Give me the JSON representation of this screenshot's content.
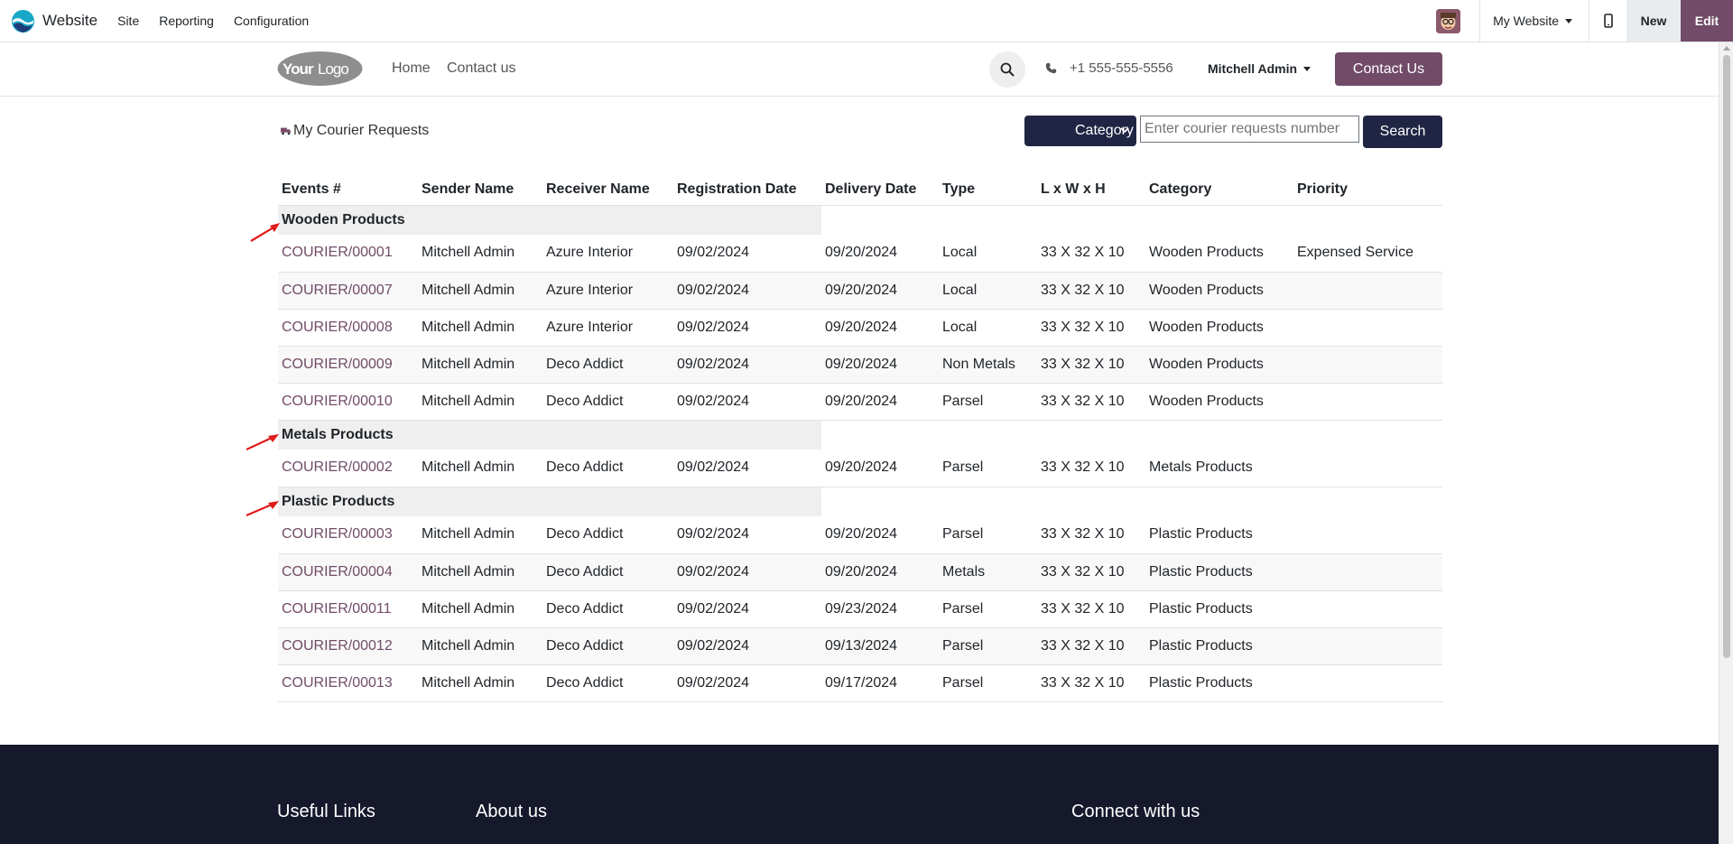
{
  "adminbar": {
    "app_title": "Website",
    "menus": [
      "Site",
      "Reporting",
      "Configuration"
    ],
    "site_switcher": "My Website",
    "new_label": "New",
    "edit_label": "Edit",
    "colors": {
      "edit_bg": "#714b67"
    }
  },
  "header": {
    "logo_text": "YourLogo",
    "nav": [
      "Home",
      "Contact us"
    ],
    "phone": "+1 555-555-5556",
    "user": "Mitchell Admin",
    "cta": "Contact Us"
  },
  "page": {
    "title": "My Courier Requests",
    "filter_selected": "Category",
    "search_placeholder": "Enter courier requests number",
    "search_button": "Search"
  },
  "table": {
    "columns": [
      "Events #",
      "Sender Name",
      "Receiver Name",
      "Registration Date",
      "Delivery Date",
      "Type",
      "L x W x H",
      "Category",
      "Priority"
    ],
    "groups": [
      {
        "name": "Wooden Products",
        "rows": [
          [
            "COURIER/00001",
            "Mitchell Admin",
            "Azure Interior",
            "09/02/2024",
            "09/20/2024",
            "Local",
            "33 X 32 X 10",
            "Wooden Products",
            "Expensed Service"
          ],
          [
            "COURIER/00007",
            "Mitchell Admin",
            "Azure Interior",
            "09/02/2024",
            "09/20/2024",
            "Local",
            "33 X 32 X 10",
            "Wooden Products",
            ""
          ],
          [
            "COURIER/00008",
            "Mitchell Admin",
            "Azure Interior",
            "09/02/2024",
            "09/20/2024",
            "Local",
            "33 X 32 X 10",
            "Wooden Products",
            ""
          ],
          [
            "COURIER/00009",
            "Mitchell Admin",
            "Deco Addict",
            "09/02/2024",
            "09/20/2024",
            "Non Metals",
            "33 X 32 X 10",
            "Wooden Products",
            ""
          ],
          [
            "COURIER/00010",
            "Mitchell Admin",
            "Deco Addict",
            "09/02/2024",
            "09/20/2024",
            "Parsel",
            "33 X 32 X 10",
            "Wooden Products",
            ""
          ]
        ]
      },
      {
        "name": "Metals Products",
        "rows": [
          [
            "COURIER/00002",
            "Mitchell Admin",
            "Deco Addict",
            "09/02/2024",
            "09/20/2024",
            "Parsel",
            "33 X 32 X 10",
            "Metals Products",
            ""
          ]
        ]
      },
      {
        "name": "Plastic Products",
        "rows": [
          [
            "COURIER/00003",
            "Mitchell Admin",
            "Deco Addict",
            "09/02/2024",
            "09/20/2024",
            "Parsel",
            "33 X 32 X 10",
            "Plastic Products",
            ""
          ],
          [
            "COURIER/00004",
            "Mitchell Admin",
            "Deco Addict",
            "09/02/2024",
            "09/20/2024",
            "Metals",
            "33 X 32 X 10",
            "Plastic Products",
            ""
          ],
          [
            "COURIER/00011",
            "Mitchell Admin",
            "Deco Addict",
            "09/02/2024",
            "09/23/2024",
            "Parsel",
            "33 X 32 X 10",
            "Plastic Products",
            ""
          ],
          [
            "COURIER/00012",
            "Mitchell Admin",
            "Deco Addict",
            "09/02/2024",
            "09/13/2024",
            "Parsel",
            "33 X 32 X 10",
            "Plastic Products",
            ""
          ],
          [
            "COURIER/00013",
            "Mitchell Admin",
            "Deco Addict",
            "09/02/2024",
            "09/17/2024",
            "Parsel",
            "33 X 32 X 10",
            "Plastic Products",
            ""
          ]
        ]
      }
    ]
  },
  "footer": {
    "headings": [
      "Useful Links",
      "About us",
      "Connect with us"
    ]
  },
  "icons": {
    "brand": "website-logo-icon",
    "search": "search-icon",
    "phone": "phone-icon",
    "mobile": "mobile-preview-icon",
    "title": "truck-icon",
    "annotation": "red-arrow-icon"
  }
}
